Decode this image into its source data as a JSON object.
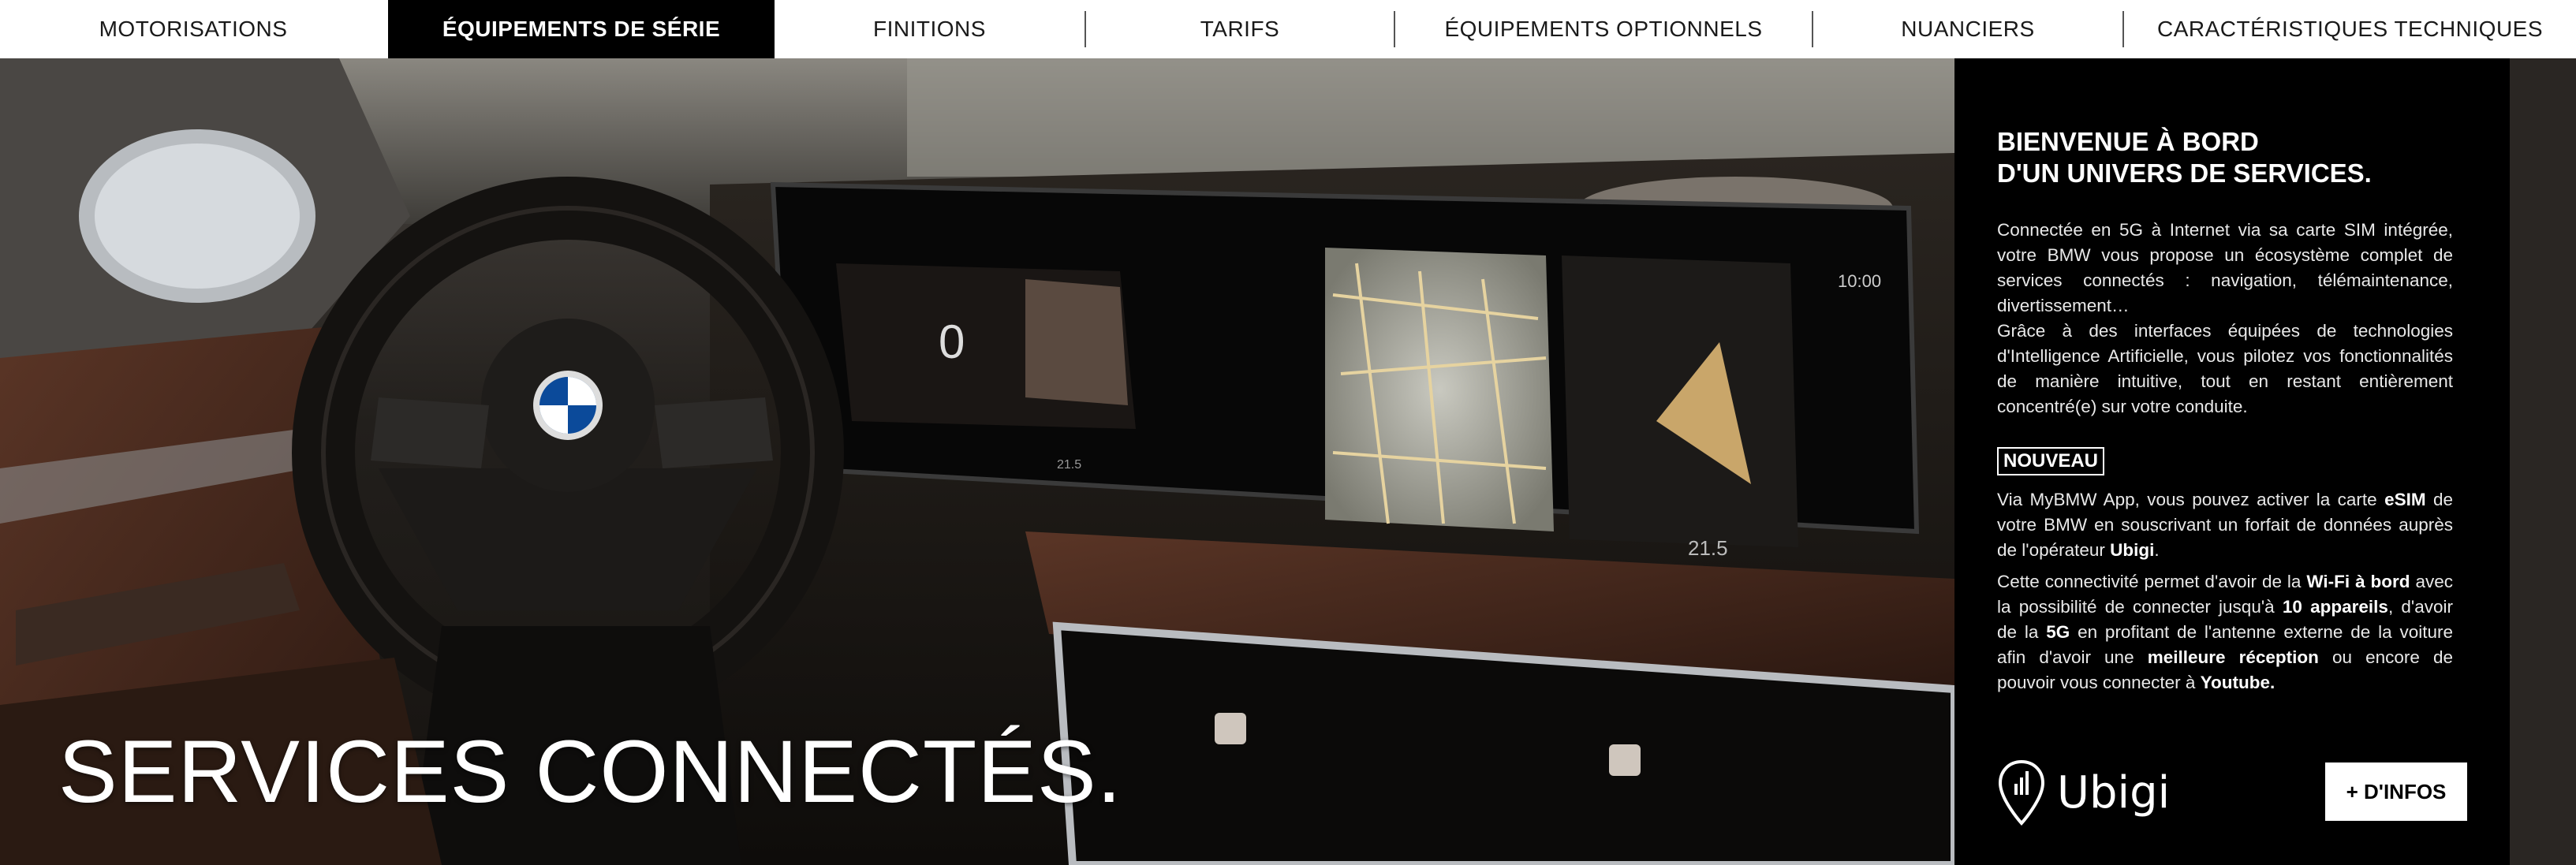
{
  "nav": {
    "items": [
      {
        "label": "MOTORISATIONS"
      },
      {
        "label": "ÉQUIPEMENTS DE SÉRIE",
        "active": true
      },
      {
        "label": "FINITIONS"
      },
      {
        "label": "TARIFS"
      },
      {
        "label": "ÉQUIPEMENTS OPTIONNELS"
      },
      {
        "label": "NUANCIERS"
      },
      {
        "label": "CARACTÉRISTIQUES TECHNIQUES"
      }
    ]
  },
  "hero": {
    "title": "SERVICES CONNECTÉS.",
    "screen_clock": "10:00",
    "screen_speed": "0",
    "screen_temp_left": "21.5",
    "screen_temp_right": "21.5"
  },
  "panel": {
    "heading_line1": "BIENVENUE À BORD",
    "heading_line2": "D'UN UNIVERS DE SERVICES.",
    "intro1": "Connectée en 5G à Internet via sa carte SIM intégrée, votre BMW vous propose un écosystème complet de services connectés : navigation, télémaintenance, divertissement…",
    "intro2": "Grâce à des interfaces équipées de technologies d'Intelligence Artificielle, vous pilotez vos fonctionnalités de manière intuitive, tout en restant entièrement concentré(e) sur votre conduite.",
    "badge": "NOUVEAU",
    "esim": {
      "pre": "Via MyBMW App, vous pouvez activer la carte ",
      "b1": "eSIM",
      "mid": " de votre BMW en souscrivant un forfait de données auprès de l'opérateur ",
      "b2": "Ubigi",
      "post": "."
    },
    "wifi": {
      "t1": "Cette connectivité permet d'avoir de la ",
      "b1": "Wi-Fi à bord",
      "t2": " avec la possibilité de connecter jusqu'à ",
      "b2": "10 appareils",
      "t3": ", d'avoir de la ",
      "b3": "5G",
      "t4": " en profitant de l'antenne externe de la voiture afin d'avoir une ",
      "b4": "meilleure réception",
      "t5": " ou encore de pouvoir vous connecter à ",
      "b5": "Youtube.",
      "t6": ""
    },
    "logo_text": "Ubigi",
    "button_label": "+ D'INFOS"
  },
  "colors": {
    "nav_active_bg": "#000000",
    "panel_bg": "#000000",
    "text": "#ffffff"
  }
}
